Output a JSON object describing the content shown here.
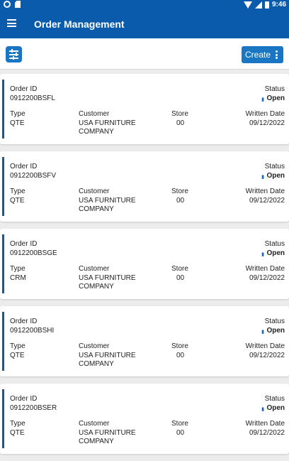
{
  "status_bar": {
    "time": "9:46"
  },
  "app_bar": {
    "title": "Order Management"
  },
  "toolbar": {
    "create_label": "Create"
  },
  "labels": {
    "order_id": "Order ID",
    "status": "Status",
    "type": "Type",
    "customer": "Customer",
    "store": "Store",
    "written_date": "Written Date"
  },
  "orders": [
    {
      "order_id": "0912200BSFL",
      "status": "Open",
      "type": "QTE",
      "customer": "USA FURNITURE COMPANY",
      "store": "00",
      "written_date": "09/12/2022"
    },
    {
      "order_id": "0912200BSFV",
      "status": "Open",
      "type": "QTE",
      "customer": "USA FURNITURE COMPANY",
      "store": "00",
      "written_date": "09/12/2022"
    },
    {
      "order_id": "0912200BSGE",
      "status": "Open",
      "type": "CRM",
      "customer": "USA FURNITURE COMPANY",
      "store": "00",
      "written_date": "09/12/2022"
    },
    {
      "order_id": "0912200BSHI",
      "status": "Open",
      "type": "QTE",
      "customer": "USA FURNITURE COMPANY",
      "store": "00",
      "written_date": "09/12/2022"
    },
    {
      "order_id": "0912200BSER",
      "status": "Open",
      "type": "QTE",
      "customer": "USA FURNITURE COMPANY",
      "store": "00",
      "written_date": "09/12/2022"
    }
  ],
  "colors": {
    "primary": "#0a5bab",
    "button": "#1a76c2",
    "status": "#1a62b6"
  }
}
